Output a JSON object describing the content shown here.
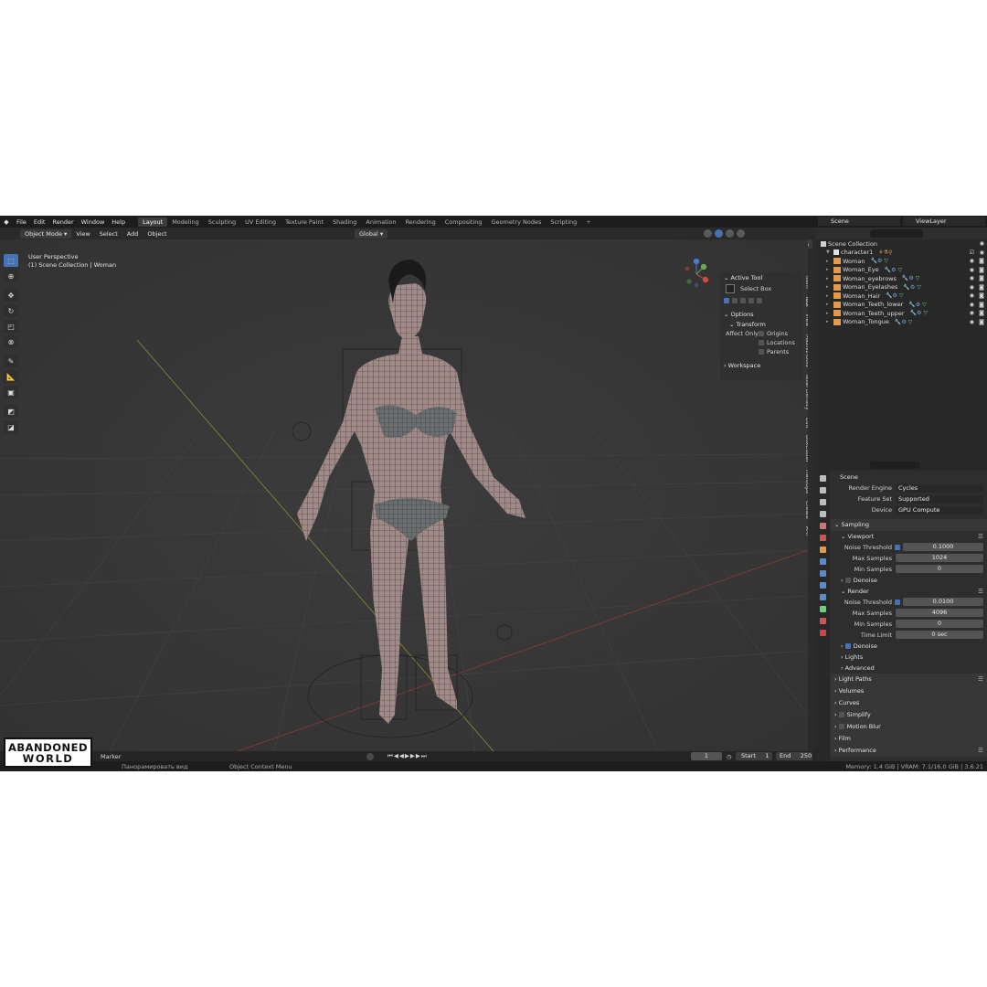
{
  "menu": [
    "File",
    "Edit",
    "Render",
    "Window",
    "Help"
  ],
  "workspaces": [
    "Layout",
    "Modeling",
    "Sculpting",
    "UV Editing",
    "Texture Paint",
    "Shading",
    "Animation",
    "Rendering",
    "Compositing",
    "Geometry Nodes",
    "Scripting"
  ],
  "active_workspace": "Layout",
  "scene_name": "Scene",
  "view_layer": "ViewLayer",
  "header": {
    "mode": "Object Mode",
    "items": [
      "View",
      "Select",
      "Add",
      "Object"
    ],
    "orientation": "Global",
    "options": "Options"
  },
  "viewport": {
    "line1": "User Perspective",
    "line2": "(1) Scene Collection | Woman"
  },
  "npanel": {
    "active_tool": "Active Tool",
    "select_box": "Select Box",
    "options": "Options",
    "transform": "Transform",
    "affect_only": "Affect Only",
    "origins": "Origins",
    "locations": "Locations",
    "parents": "Parents",
    "workspace": "Workspace"
  },
  "vertical_tabs": [
    "Item",
    "Tool",
    "View",
    "MaxivzTools",
    "Texel Density",
    "Edit",
    "BoxCutter",
    "HardOps",
    "Create",
    "ARP"
  ],
  "outliner": {
    "root": "Scene Collection",
    "collection": "character1",
    "objects": [
      "Woman",
      "Woman_Eye",
      "Woman_eyebrows",
      "Woman_Eyelashes",
      "Woman_Hair",
      "Woman_Teeth_lower",
      "Woman_Teeth_upper",
      "Woman_Tongue"
    ]
  },
  "properties": {
    "title": "Scene",
    "render_engine_label": "Render Engine",
    "render_engine": "Cycles",
    "feature_set_label": "Feature Set",
    "feature_set": "Supported",
    "device_label": "Device",
    "device": "GPU Compute",
    "sampling": "Sampling",
    "viewport": "Viewport",
    "noise_threshold_label": "Noise Threshold",
    "viewport_noise": "0.1000",
    "max_samples_label": "Max Samples",
    "viewport_max": "1024",
    "min_samples_label": "Min Samples",
    "viewport_min": "0",
    "denoise": "Denoise",
    "render": "Render",
    "render_noise": "0.0100",
    "render_max": "4096",
    "render_min": "0",
    "time_limit_label": "Time Limit",
    "time_limit": "0 sec",
    "denoise2": "Denoise",
    "lights": "Lights",
    "advanced": "Advanced",
    "sections": [
      "Light Paths",
      "Volumes",
      "Curves",
      "Simplify",
      "Motion Blur",
      "Film",
      "Performance"
    ]
  },
  "timeline": {
    "marker": "Marker",
    "frame": "1",
    "start_label": "Start",
    "start": "1",
    "end_label": "End",
    "end": "250"
  },
  "status": {
    "left": "Панорамировать вид",
    "middle": "Object Context Menu",
    "right": "Memory: 1.4 GiB | VRAM: 7.1/16.0 GiB | 3.6.21"
  },
  "watermark": {
    "line1": "ABANDONED",
    "line2": "WORLD"
  },
  "colors": {
    "accent": "#4772b3",
    "viewport_bg": "#393939",
    "object_icon": "#e39a4a",
    "mesh_data": "#6ccf7a"
  }
}
